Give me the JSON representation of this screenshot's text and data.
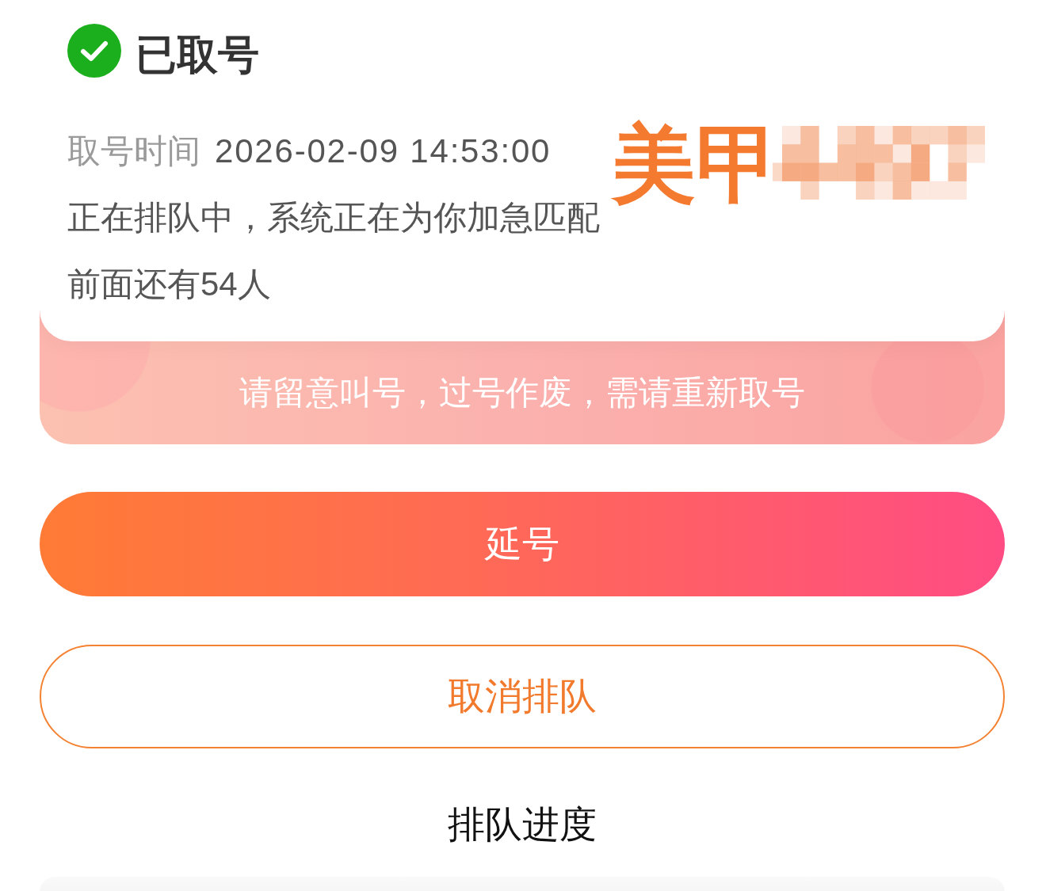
{
  "status": {
    "title": "已取号"
  },
  "ticket": {
    "time_label": "取号时间",
    "time_value": "2026-02-09 14:53:00",
    "message": "正在排队中，系统正在为你加急匹配",
    "ahead": "前面还有54人"
  },
  "overlay_label": {
    "text": "美甲",
    "redacted": true
  },
  "notice": "请留意叫号，过号作废，需请重新取号",
  "buttons": [
    {
      "label": "延号",
      "kind": "primary"
    },
    {
      "label": "取消排队",
      "kind": "outline"
    },
    {
      "label": "排队进度",
      "kind": "text"
    }
  ]
}
